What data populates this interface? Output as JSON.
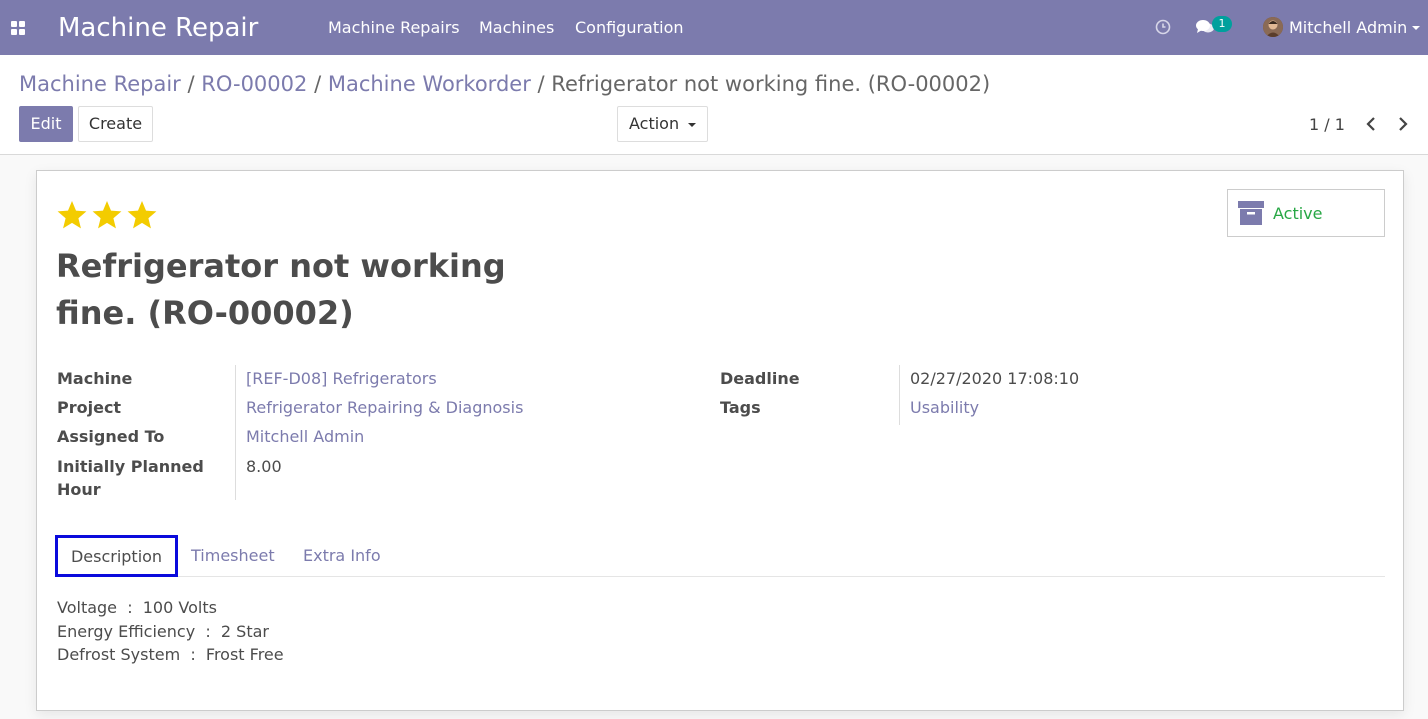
{
  "navbar": {
    "app_title": "Machine Repair",
    "menu": [
      "Machine Repairs",
      "Machines",
      "Configuration"
    ],
    "message_count": "1",
    "user_name": "Mitchell Admin",
    "background": "#7c7bad",
    "icons": [
      "apps-icon",
      "clock-icon",
      "chat-icon",
      "avatar",
      "chevron-down-icon"
    ]
  },
  "breadcrumb": {
    "items": [
      "Machine Repair",
      "RO-00002",
      "Machine Workorder"
    ],
    "separator": "/",
    "current": "Refrigerator not working fine. (RO-00002)"
  },
  "buttons": {
    "edit": "Edit",
    "create": "Create",
    "action": "Action"
  },
  "pager": {
    "value": "1 / 1"
  },
  "record": {
    "priority_stars": 3,
    "status_button": "Active",
    "title": "Refrigerator not working fine. (RO-00002)",
    "fields_left": [
      {
        "label": "Machine",
        "value": "[REF-D08] Refrigerators",
        "link": true
      },
      {
        "label": "Project",
        "value": "Refrigerator Repairing & Diagnosis",
        "link": true
      },
      {
        "label": "Assigned To",
        "value": "Mitchell Admin",
        "link": true
      },
      {
        "label": "Initially Planned Hour",
        "label_lines": [
          "Initially Planned",
          "Hour"
        ],
        "value": "8.00",
        "link": false
      }
    ],
    "fields_right": [
      {
        "label": "Deadline",
        "value": "02/27/2020 17:08:10",
        "link": false
      },
      {
        "label": "Tags",
        "value": "Usability",
        "link": true
      }
    ]
  },
  "tabs": {
    "items": [
      "Description",
      "Timesheet",
      "Extra Info"
    ],
    "active": "Description"
  },
  "description": {
    "lines": [
      "Voltage  :  100 Volts",
      "Energy Efficiency  :  2 Star",
      "Defrost System  :  Frost Free"
    ]
  },
  "colors": {
    "accent": "#7c7bad",
    "active_status": "#28a745",
    "star": "#f3cc00",
    "tab_highlight": "#0a0adc"
  }
}
